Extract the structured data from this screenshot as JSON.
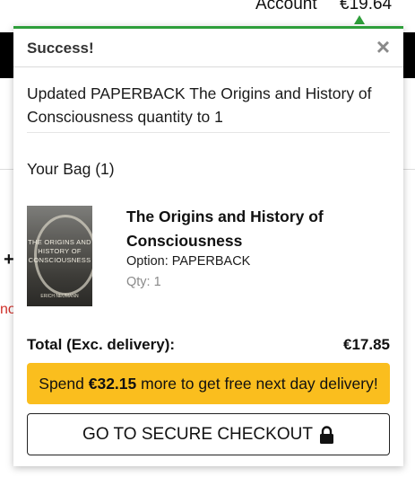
{
  "header": {
    "account_label": "Account",
    "bag_total": "€19.64"
  },
  "background": {
    "plus_glyph": "+",
    "partial_text": "no"
  },
  "popup": {
    "title": "Success!",
    "close_glyph": "×",
    "message": "Updated PAPERBACK The Origins and History of Consciousness quantity to 1",
    "bag_title": "Your Bag (1)",
    "item": {
      "cover_title": "THE ORIGINS AND HISTORY OF CONSCIOUSNESS",
      "cover_author": "ERICH NEUMANN",
      "title": "The Origins and History of Consciousness",
      "option": "Option: PAPERBACK",
      "qty": "Qty: 1"
    },
    "total_label": "Total (Exc. delivery):",
    "total_value": "€17.85",
    "delivery": {
      "prefix": "Spend ",
      "amount": "€32.15",
      "suffix": " more to get free next day delivery!"
    },
    "checkout_label": "GO TO SECURE CHECKOUT",
    "checkout_icon": "lock-icon"
  },
  "colors": {
    "success_accent": "#2e9e3a",
    "delivery_banner": "#fabe1e",
    "header_band": "#000000"
  }
}
